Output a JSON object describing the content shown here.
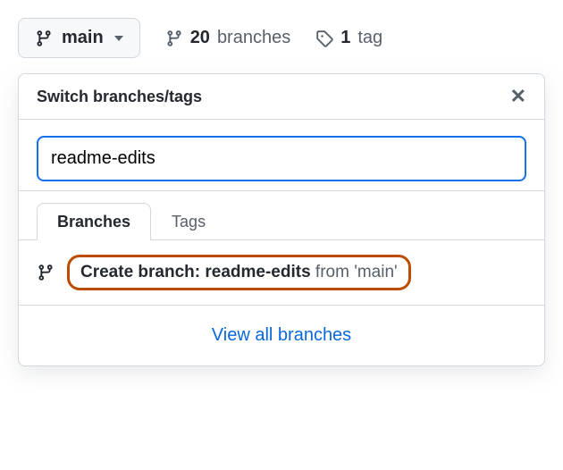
{
  "branch_button": {
    "label": "main"
  },
  "stats": {
    "branches": {
      "count": "20",
      "label": "branches"
    },
    "tags": {
      "count": "1",
      "label": "tag"
    }
  },
  "popover": {
    "title": "Switch branches/tags",
    "input_value": "readme-edits",
    "tabs": {
      "branches": "Branches",
      "tags": "Tags"
    },
    "create": {
      "prefix": "Create branch: ",
      "name": "readme-edits",
      "from": " from 'main'"
    },
    "view_all": "View all branches"
  }
}
